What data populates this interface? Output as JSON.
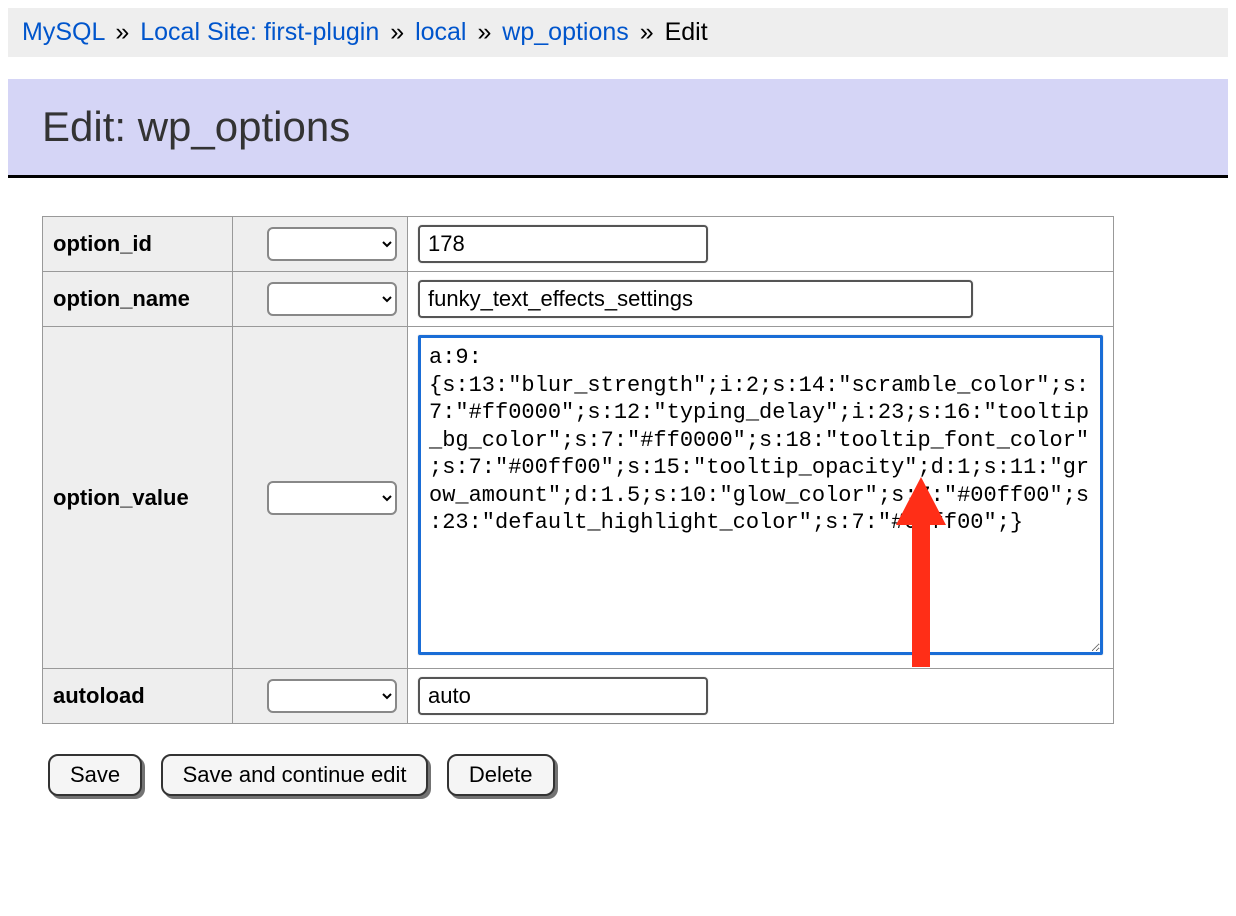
{
  "breadcrumb": {
    "items": [
      {
        "label": "MySQL",
        "link": true
      },
      {
        "label": "Local Site: first-plugin",
        "link": true
      },
      {
        "label": "local",
        "link": true
      },
      {
        "label": "wp_options",
        "link": true
      },
      {
        "label": "Edit",
        "link": false
      }
    ],
    "separator": "»"
  },
  "page_title": "Edit: wp_options",
  "fields": {
    "option_id": {
      "label": "option_id",
      "value": "178"
    },
    "option_name": {
      "label": "option_name",
      "value": "funky_text_effects_settings"
    },
    "option_value": {
      "label": "option_value",
      "value": "a:9:{s:13:\"blur_strength\";i:2;s:14:\"scramble_color\";s:7:\"#ff0000\";s:12:\"typing_delay\";i:23;s:16:\"tooltip_bg_color\";s:7:\"#ff0000\";s:18:\"tooltip_font_color\";s:7:\"#00ff00\";s:15:\"tooltip_opacity\";d:1;s:11:\"grow_amount\";d:1.5;s:10:\"glow_color\";s:7:\"#00ff00\";s:23:\"default_highlight_color\";s:7:\"#00ff00\";}"
    },
    "autoload": {
      "label": "autoload",
      "value": "auto"
    }
  },
  "actions": {
    "save": "Save",
    "save_continue": "Save and continue edit",
    "delete": "Delete"
  },
  "annotation": {
    "arrow_color": "#ff2e17"
  }
}
